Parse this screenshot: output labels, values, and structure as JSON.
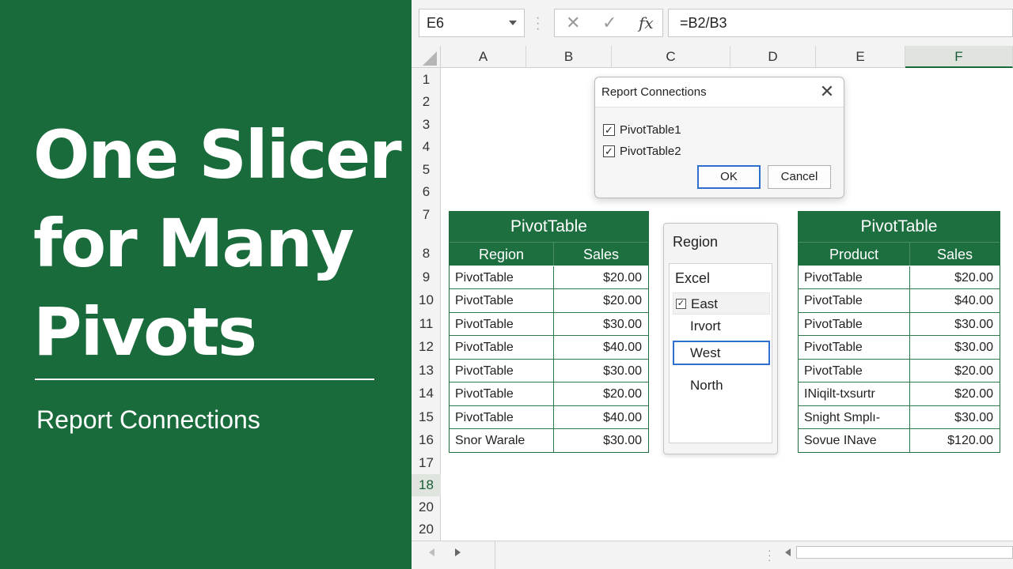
{
  "hero": {
    "title_lines": [
      "One Slicer",
      "for Many",
      "Pivots"
    ],
    "subtitle": "Report Connections"
  },
  "formula_bar": {
    "name_box": "E6",
    "cancel_icon": "✕",
    "enter_icon": "✓",
    "fx_label": "fx",
    "formula": "=B2/B3"
  },
  "columns": [
    "A",
    "B",
    "C",
    "D",
    "E",
    "F"
  ],
  "selected_column": "F",
  "rows": [
    "1",
    "2",
    "3",
    "4",
    "5",
    "6",
    "7",
    "8",
    "9",
    "10",
    "11",
    "12",
    "13",
    "14",
    "15",
    "16",
    "17",
    "18",
    "20",
    "20"
  ],
  "selected_row": "18",
  "dialog": {
    "title": "Report Connections",
    "close_icon": "✕",
    "items": [
      {
        "label": "PivotTable1",
        "checked": true
      },
      {
        "label": "PivotTable2",
        "checked": true
      }
    ],
    "ok_label": "OK",
    "cancel_label": "Cancel"
  },
  "pivot_left": {
    "title": "PivotTable",
    "headers": [
      "Region",
      "Sales"
    ],
    "rows": [
      [
        "PivotTable",
        "$20.00"
      ],
      [
        "PivotTable",
        "$20.00"
      ],
      [
        "PivotTable",
        "$30.00"
      ],
      [
        "PivotTable",
        "$40.00"
      ],
      [
        "PivotTable",
        "$30.00"
      ],
      [
        "PivotTable",
        "$20.00"
      ],
      [
        "PivotTable",
        "$40.00"
      ],
      [
        "Snor Warale",
        "$30.00"
      ]
    ]
  },
  "slicer": {
    "title": "Region",
    "header": "Excel",
    "items": [
      "East",
      "Irvort",
      "West",
      "North"
    ],
    "checked_item": "East",
    "selected_item": "West"
  },
  "pivot_right": {
    "title": "PivotTable",
    "headers": [
      "Product",
      "Sales"
    ],
    "rows": [
      [
        "PivotTable",
        "$20.00"
      ],
      [
        "PivotTable",
        "$40.00"
      ],
      [
        "PivotTable",
        "$30.00"
      ],
      [
        "PivotTable",
        "$30.00"
      ],
      [
        "PivotTable",
        "$20.00"
      ],
      [
        "INiqilt-txsurtr",
        "$20.00"
      ],
      [
        "Snight Smplı-",
        "$30.00"
      ],
      [
        "Sovue INave",
        "$120.00"
      ]
    ]
  },
  "colors": {
    "brand_green": "#1a6b3c",
    "focus_blue": "#2f6fd0"
  }
}
